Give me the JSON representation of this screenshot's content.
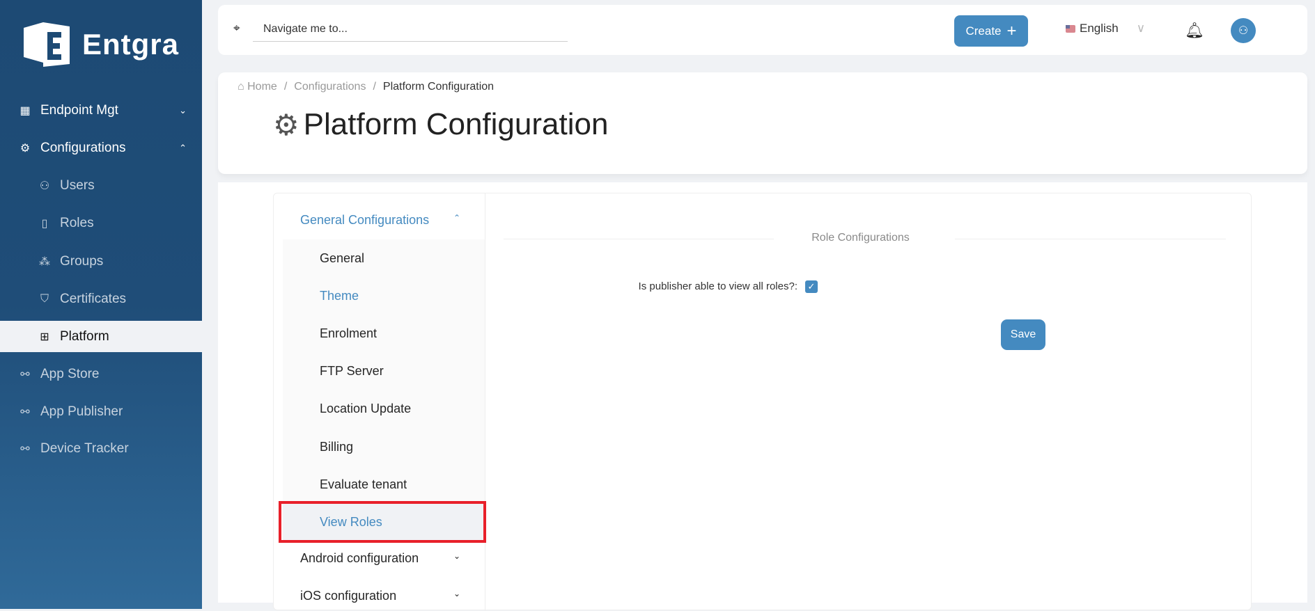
{
  "brand": {
    "name": "Entgra"
  },
  "sidebar": {
    "items": [
      {
        "label": "Endpoint Mgt",
        "icon": "grid-icon",
        "chevron": "down"
      },
      {
        "label": "Configurations",
        "icon": "gear-icon",
        "chevron": "up"
      },
      {
        "label": "Users",
        "icon": "user-icon"
      },
      {
        "label": "Roles",
        "icon": "book-icon"
      },
      {
        "label": "Groups",
        "icon": "nodes-icon"
      },
      {
        "label": "Certificates",
        "icon": "shield-icon"
      },
      {
        "label": "Platform",
        "icon": "sliders-icon",
        "active": true
      },
      {
        "label": "App Store",
        "icon": "link-icon"
      },
      {
        "label": "App Publisher",
        "icon": "link-icon"
      },
      {
        "label": "Device Tracker",
        "icon": "link-icon"
      }
    ]
  },
  "topbar": {
    "nav_placeholder": "Navigate me to...",
    "create_label": "Create",
    "language": "English"
  },
  "breadcrumb": {
    "home": "Home",
    "sep": "/",
    "configurations": "Configurations",
    "current": "Platform Configuration"
  },
  "page_title": "Platform Configuration",
  "menu": {
    "general": "General Configurations",
    "items": [
      "General",
      "Theme",
      "Enrolment",
      "FTP Server",
      "Location Update",
      "Billing",
      "Evaluate tenant",
      "View Roles"
    ],
    "android": "Android configuration",
    "ios": "iOS configuration"
  },
  "role_config": {
    "title": "Role Configurations",
    "question": "Is publisher able to view all roles?:",
    "checked": true,
    "save_label": "Save"
  },
  "colors": {
    "accent": "#448ac0",
    "sidebar": "#1d4a74",
    "highlight": "#e8202a"
  }
}
